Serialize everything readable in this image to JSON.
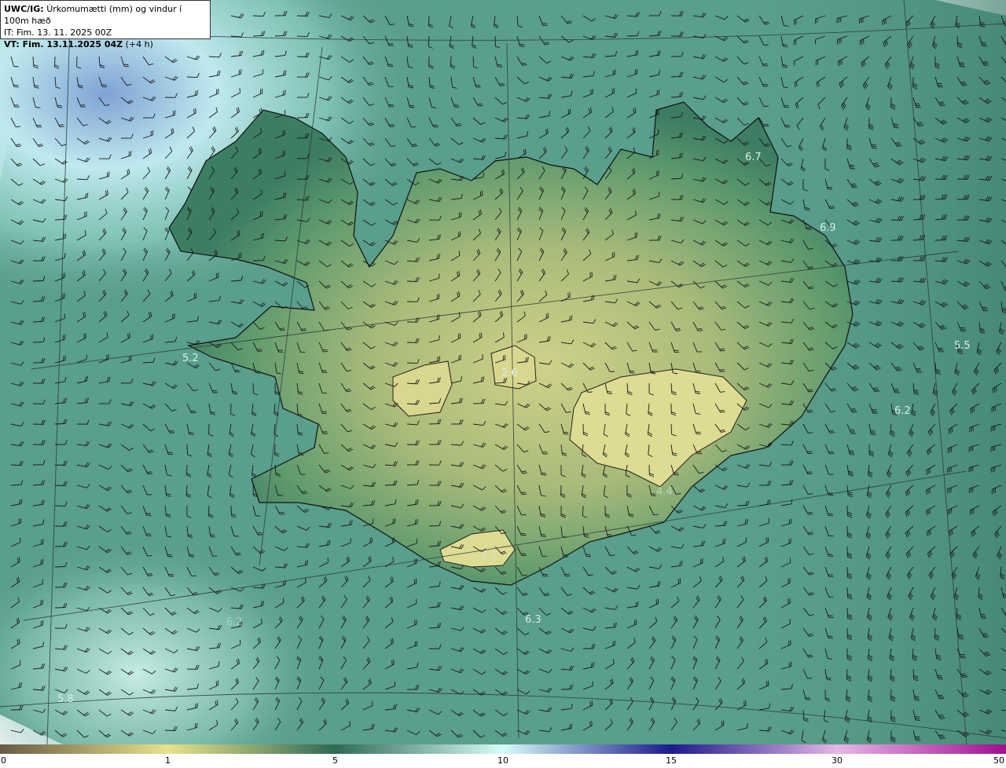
{
  "header": {
    "product_code": "UWC/IG:",
    "product_desc": "Úrkomumætti (mm) og vindur í 100m hæð",
    "initial_time": "IT: Fim. 13. 11. 2025 00Z",
    "valid_time_bold": "VT: Fim. 13.11.2025 04Z",
    "valid_time_offset": "(+4 h)"
  },
  "colorbar": {
    "ticks": [
      "0",
      "1",
      "5",
      "10",
      "15",
      "30",
      "50"
    ],
    "stops": [
      {
        "value": "0",
        "color": "#6b5a45"
      },
      {
        "value": "1",
        "color": "#e9e28a"
      },
      {
        "value": "5",
        "color": "#2f6a55"
      },
      {
        "value": "10",
        "color": "#d7fbf8"
      },
      {
        "value": "15",
        "color": "#1c1a8c"
      },
      {
        "value": "30",
        "color": "#e6b6e6"
      },
      {
        "value": "50",
        "color": "#a01090"
      }
    ]
  },
  "map_labels": [
    "6.7",
    "6.9",
    "5.5",
    "6.2",
    "5.2",
    "2.6",
    "6.3",
    "5.8",
    "6.2",
    "2.2",
    "4.4"
  ],
  "colors": {
    "ocean": "#5a9e8d",
    "land_low": "#3d7d62",
    "land_high": "#cdd089",
    "moist_northwest": "#cfeff0",
    "coast_line": "#111111",
    "barb": "#1a1a1a"
  }
}
